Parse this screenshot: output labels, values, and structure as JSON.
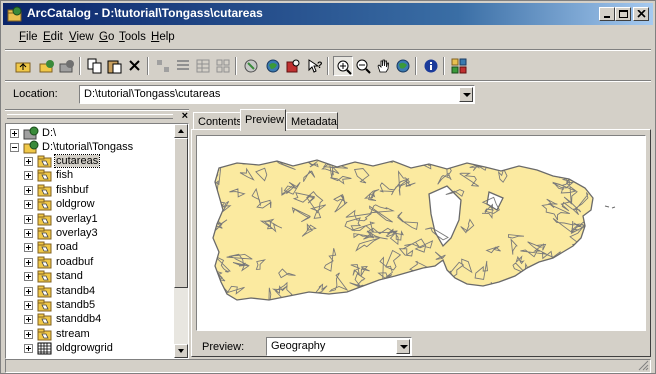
{
  "window": {
    "title": "ArcCatalog - D:\\tutorial\\Tongass\\cutareas"
  },
  "menu": [
    {
      "label": "File",
      "key": "F",
      "rest": "ile"
    },
    {
      "label": "Edit",
      "key": "E",
      "rest": "dit"
    },
    {
      "label": "View",
      "key": "V",
      "rest": "iew"
    },
    {
      "label": "Go",
      "key": "G",
      "rest": "o"
    },
    {
      "label": "Tools",
      "key": "T",
      "rest": "ools"
    },
    {
      "label": "Help",
      "key": "H",
      "rest": "elp"
    }
  ],
  "toolbar": {
    "icons": [
      "up-one-level-icon",
      "connect-folder-icon",
      "disconnect-folder-icon",
      "copy-icon",
      "paste-icon",
      "delete-icon",
      "large-icons-icon",
      "list-icon",
      "details-icon",
      "thumbnails-icon",
      "launch-arcmap-icon",
      "catalog-tree-icon",
      "search-icon",
      "whats-this-icon",
      "zoom-in-icon",
      "zoom-out-icon",
      "pan-icon",
      "full-extent-icon",
      "identify-icon",
      "create-thumbnail-icon"
    ]
  },
  "location": {
    "label": "Location:",
    "value": "D:\\tutorial\\Tongass\\cutareas"
  },
  "tree": {
    "root": "D:\\",
    "folder": "D:\\tutorial\\Tongass",
    "items": [
      {
        "label": "cutareas",
        "selected": true,
        "type": "coverage"
      },
      {
        "label": "fish",
        "type": "coverage"
      },
      {
        "label": "fishbuf",
        "type": "coverage"
      },
      {
        "label": "oldgrow",
        "type": "coverage"
      },
      {
        "label": "overlay1",
        "type": "coverage"
      },
      {
        "label": "overlay3",
        "type": "coverage"
      },
      {
        "label": "road",
        "type": "coverage"
      },
      {
        "label": "roadbuf",
        "type": "coverage"
      },
      {
        "label": "stand",
        "type": "coverage"
      },
      {
        "label": "standb4",
        "type": "coverage"
      },
      {
        "label": "standb5",
        "type": "coverage"
      },
      {
        "label": "standdb4",
        "type": "coverage"
      },
      {
        "label": "stream",
        "type": "coverage"
      },
      {
        "label": "oldgrowgrid",
        "type": "grid"
      }
    ]
  },
  "tabs": [
    {
      "label": "Contents",
      "active": false
    },
    {
      "label": "Preview",
      "active": true
    },
    {
      "label": "Metadata",
      "active": false
    }
  ],
  "preview": {
    "label": "Preview:",
    "value": "Geography"
  },
  "colors": {
    "polygon_fill": "#fbeaa0",
    "polygon_edge": "#7a7a7a",
    "title_start": "#0a246a",
    "title_end": "#a6caf0"
  }
}
